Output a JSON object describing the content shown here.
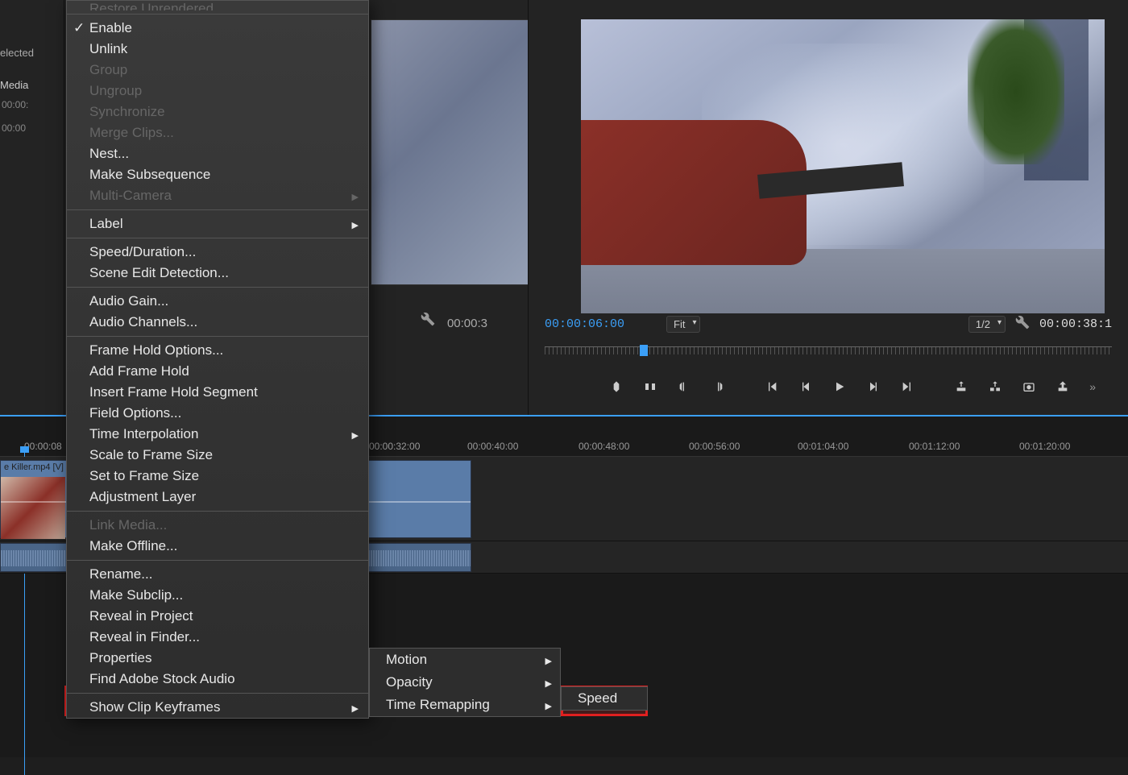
{
  "leftPanel": {
    "selectedText": "elected",
    "mediaLabel": "Media",
    "tc1": "00:00:",
    "tc2": "00:00"
  },
  "sourceMonitor": {
    "timecode": "00:00:3"
  },
  "programMonitor": {
    "currentTimecode": "00:00:06:00",
    "fitLabel": "Fit",
    "resolutionLabel": "1/2",
    "durationTimecode": "00:00:38:1"
  },
  "timeline": {
    "clipName": "e Killer.mp4 [V]",
    "rulerMarks": [
      "00:00:08",
      "00:00:32:00",
      "00:00:40:00",
      "00:00:48:00",
      "00:00:56:00",
      "00:01:04:00",
      "00:01:12:00",
      "00:01:20:00"
    ]
  },
  "contextMenu": {
    "items": [
      {
        "label": "Restore Unrendered",
        "disabled": true,
        "cutoff": true
      },
      {
        "sep": true
      },
      {
        "label": "Enable",
        "checked": true
      },
      {
        "label": "Unlink"
      },
      {
        "label": "Group",
        "disabled": true
      },
      {
        "label": "Ungroup",
        "disabled": true
      },
      {
        "label": "Synchronize",
        "disabled": true
      },
      {
        "label": "Merge Clips...",
        "disabled": true
      },
      {
        "label": "Nest..."
      },
      {
        "label": "Make Subsequence"
      },
      {
        "label": "Multi-Camera",
        "disabled": true,
        "submenu": true
      },
      {
        "sep": true
      },
      {
        "label": "Label",
        "submenu": true
      },
      {
        "sep": true
      },
      {
        "label": "Speed/Duration..."
      },
      {
        "label": "Scene Edit Detection..."
      },
      {
        "sep": true
      },
      {
        "label": "Audio Gain..."
      },
      {
        "label": "Audio Channels..."
      },
      {
        "sep": true
      },
      {
        "label": "Frame Hold Options..."
      },
      {
        "label": "Add Frame Hold"
      },
      {
        "label": "Insert Frame Hold Segment"
      },
      {
        "label": "Field Options..."
      },
      {
        "label": "Time Interpolation",
        "submenu": true
      },
      {
        "label": "Scale to Frame Size"
      },
      {
        "label": "Set to Frame Size"
      },
      {
        "label": "Adjustment Layer"
      },
      {
        "sep": true
      },
      {
        "label": "Link Media...",
        "disabled": true
      },
      {
        "label": "Make Offline..."
      },
      {
        "sep": true
      },
      {
        "label": "Rename..."
      },
      {
        "label": "Make Subclip..."
      },
      {
        "label": "Reveal in Project"
      },
      {
        "label": "Reveal in Finder..."
      },
      {
        "label": "Properties"
      },
      {
        "label": "Find Adobe Stock Audio"
      },
      {
        "sep": true
      },
      {
        "label": "Show Clip Keyframes",
        "submenu": true
      }
    ]
  },
  "submenu1": {
    "items": [
      {
        "label": "Motion",
        "submenu": true
      },
      {
        "label": "Opacity",
        "submenu": true
      },
      {
        "label": "Time Remapping",
        "submenu": true
      }
    ]
  },
  "submenu2": {
    "items": [
      {
        "label": "Speed"
      }
    ]
  }
}
